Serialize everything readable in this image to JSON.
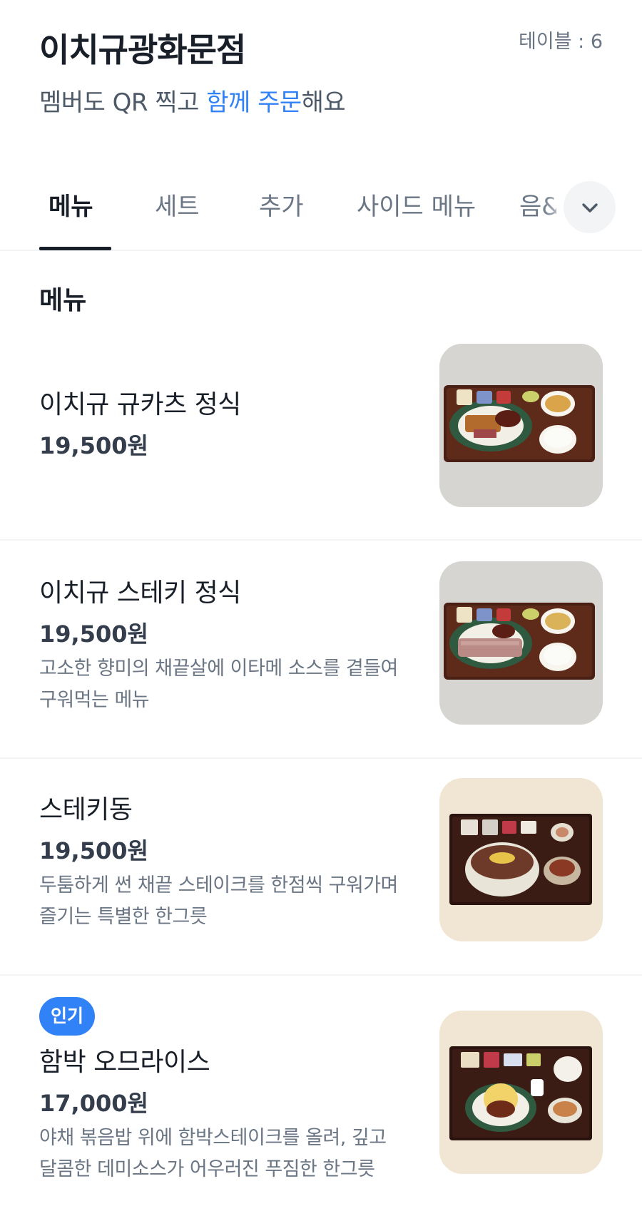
{
  "header": {
    "store_name": "이치규광화문점",
    "table": "테이블 : 6",
    "subtitle_prefix": "멤버도 QR 찍고 ",
    "subtitle_highlight": "함께 주문",
    "subtitle_suffix": "해요"
  },
  "tabs": [
    {
      "label": "메뉴",
      "active": true
    },
    {
      "label": "세트",
      "active": false
    },
    {
      "label": "추가",
      "active": false
    },
    {
      "label": "사이드 메뉴",
      "active": false
    },
    {
      "label": "음&",
      "active": false
    }
  ],
  "section": {
    "title": "메뉴"
  },
  "menu_items": [
    {
      "name": "이치규 규카츠 정식",
      "price": "19,500원",
      "description": "",
      "badge": "",
      "image": "gyukatsu-set-photo"
    },
    {
      "name": "이치규 스테키 정식",
      "price": "19,500원",
      "description_line1": "고소한 향미의 채끝살에 이타메 소스를 곁들여",
      "description_line2": "구워먹는 메뉴",
      "badge": "",
      "image": "steak-set-photo"
    },
    {
      "name": "스테키동",
      "price": "19,500원",
      "description_line1": "두툼하게 썬 채끝 스테이크를 한점씩 구워가며",
      "description_line2": "즐기는 특별한 한그릇",
      "badge": "",
      "image": "steak-don-photo"
    },
    {
      "name": "함박 오므라이스",
      "price": "17,000원",
      "description_line1": "야채 볶음밥 위에 함박스테이크를 올려, 깊고",
      "description_line2": "달콤한 데미소스가 어우러진 푸짐한 한그릇",
      "badge": "인기",
      "image": "hambak-omurice-photo"
    }
  ],
  "icons": {
    "tab_expand": "chevron-down-icon"
  },
  "colors": {
    "accent": "#3182f6",
    "text": "#191f28",
    "sub_text": "#6b7684",
    "divider": "#f2f4f6"
  }
}
